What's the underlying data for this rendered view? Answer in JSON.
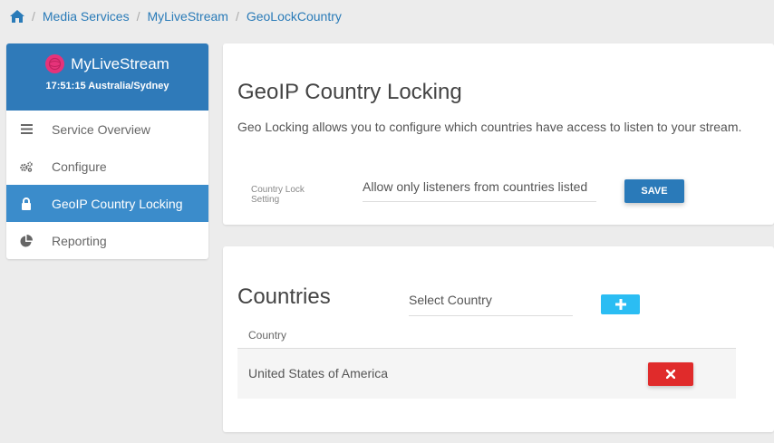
{
  "breadcrumb": {
    "home_icon": "home-icon",
    "items": [
      "Media Services",
      "MyLiveStream",
      "GeoLockCountry"
    ],
    "separator": "/"
  },
  "sidebar": {
    "title": "MyLiveStream",
    "time": "17:51:15 Australia/Sydney",
    "items": [
      {
        "label": "Service Overview",
        "icon": "list-icon"
      },
      {
        "label": "Configure",
        "icon": "gears-icon"
      },
      {
        "label": "GeoIP Country Locking",
        "icon": "lock-icon",
        "active": true
      },
      {
        "label": "Reporting",
        "icon": "pie-chart-icon"
      }
    ]
  },
  "geolock": {
    "title": "GeoIP Country Locking",
    "description": "Geo Locking allows you to configure which countries have access to listen to your stream.",
    "field_label": "Country Lock Setting",
    "setting_value": "Allow only listeners from countries listed",
    "save_label": "SAVE"
  },
  "countries": {
    "title": "Countries",
    "select_placeholder": "Select Country",
    "add_icon": "plus-icon",
    "column_header": "Country",
    "rows": [
      {
        "name": "United States of America"
      }
    ],
    "delete_icon": "close-icon"
  },
  "colors": {
    "primary": "#2f7ab9",
    "active_item": "#3b8ccb",
    "accent_add": "#2bbdf3",
    "danger": "#e02b2b",
    "logo": "#e6337a"
  }
}
